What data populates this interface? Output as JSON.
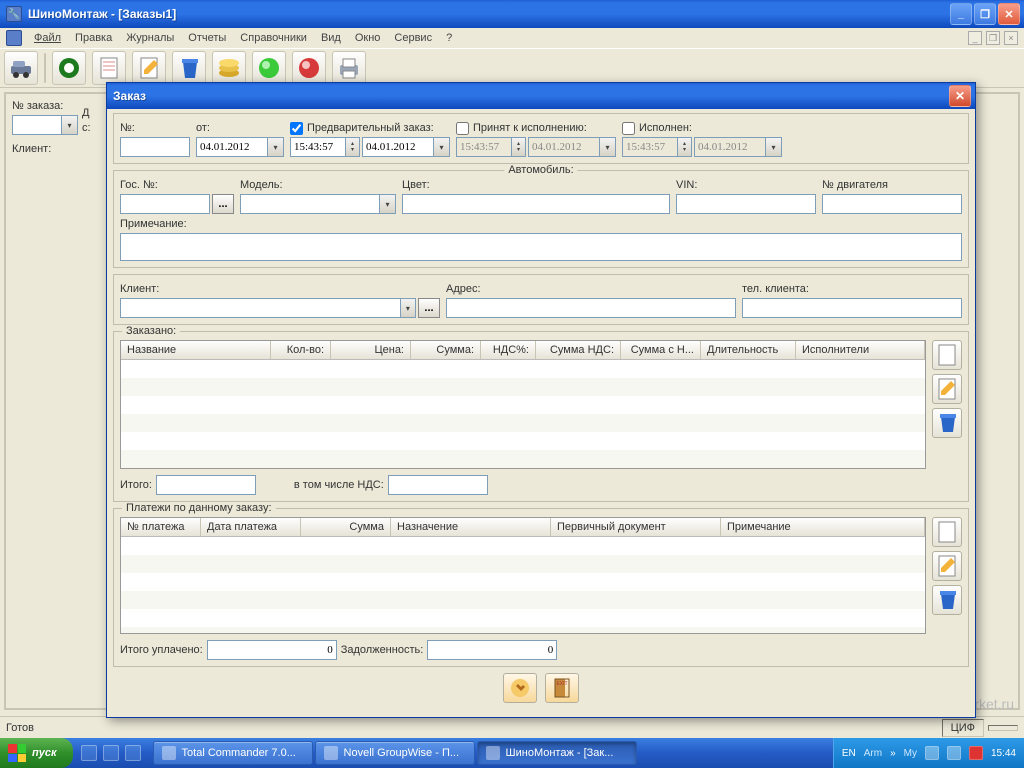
{
  "app": {
    "title": "ШиноМонтаж - [Заказы1]"
  },
  "menu": {
    "file": "Файл",
    "edit": "Правка",
    "journals": "Журналы",
    "reports": "Отчеты",
    "refs": "Справочники",
    "view": "Вид",
    "window": "Окно",
    "service": "Сервис",
    "help": "?"
  },
  "backform": {
    "lbl_orderno": "№ заказа:",
    "lbl_d": "Д",
    "lbl_c": "с:",
    "lbl_client": "Клиент:"
  },
  "statusbar": {
    "ready": "Готов",
    "cif": "ЦИФ"
  },
  "watermark": "softmarket.ru",
  "modal": {
    "title": "Заказ",
    "row1": {
      "lbl_no": "№:",
      "lbl_ot": "от:",
      "chk_preorder": "Предварительный заказ:",
      "chk_accepted": "Принят к исполнению:",
      "chk_done": "Исполнен:",
      "date": "04.01.2012",
      "time": "15:43:57",
      "date_disabled": "04.01.2012",
      "time_disabled": "15:43:57"
    },
    "auto": {
      "legend": "Автомобиль:",
      "gosno": "Гос. №:",
      "model": "Модель:",
      "color": "Цвет:",
      "vin": "VIN:",
      "engine": "№ двигателя",
      "note": "Примечание:"
    },
    "client": {
      "lbl": "Клиент:",
      "addr": "Адрес:",
      "phone": "тел. клиента:"
    },
    "ordered": {
      "legend": "Заказано:",
      "cols": [
        "Название",
        "Кол-во:",
        "Цена:",
        "Сумма:",
        "НДС%:",
        "Сумма НДС:",
        "Сумма с Н...",
        "Длительность",
        "Исполнители"
      ],
      "total": "Итого:",
      "vat": "в том числе НДС:"
    },
    "payments": {
      "legend": "Платежи по данному заказу:",
      "cols": [
        "№ платежа",
        "Дата платежа",
        "Сумма",
        "Назначение",
        "Первичный документ",
        "Примечание"
      ],
      "paid": "Итого уплачено:",
      "paid_val": "0",
      "debt": "Задолженность:",
      "debt_val": "0"
    }
  },
  "taskbar": {
    "start": "пуск",
    "tasks": [
      {
        "label": "Total Commander 7.0..."
      },
      {
        "label": "Novell GroupWise - П..."
      },
      {
        "label": "ШиноМонтаж - [Зак...",
        "active": true
      }
    ],
    "tray": {
      "lang": "EN",
      "arm": "Arm",
      "my": "My",
      "time": "15:44"
    }
  }
}
